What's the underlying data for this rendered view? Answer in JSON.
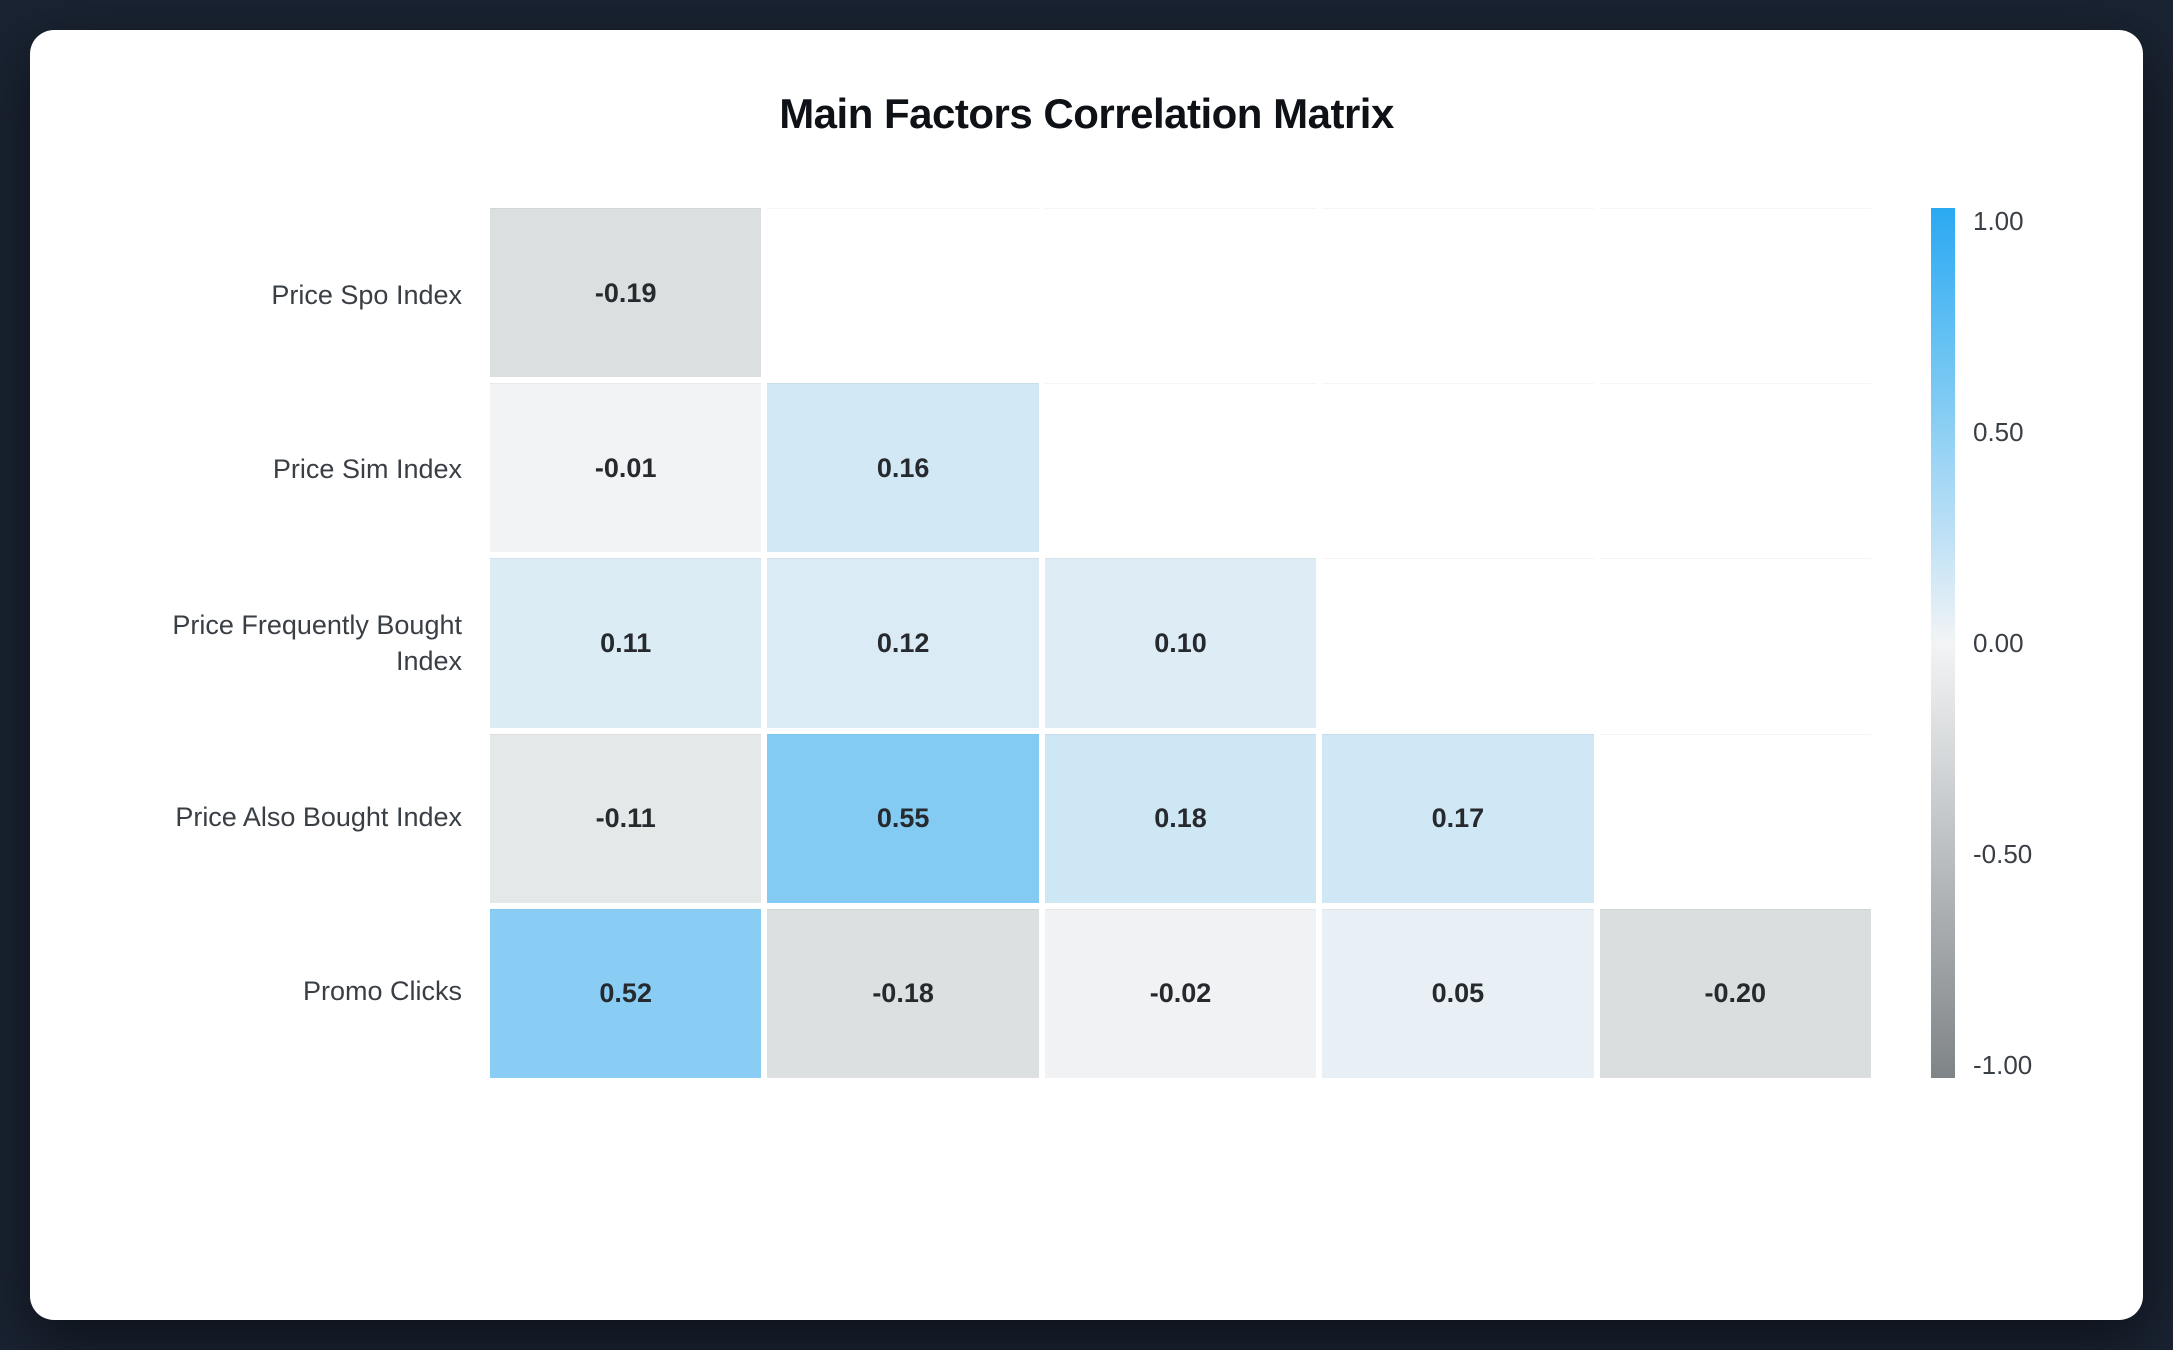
{
  "title": "Main Factors Correlation Matrix",
  "chart_data": {
    "type": "heatmap",
    "title": "Main Factors Correlation Matrix",
    "row_labels": [
      "Price Spo Index",
      "Price Sim Index",
      "Price Frequently Bought Index",
      "Price Also Bought Index",
      "Promo Clicks"
    ],
    "columns": 5,
    "matrix": [
      [
        -0.19,
        null,
        null,
        null,
        null
      ],
      [
        -0.01,
        0.16,
        null,
        null,
        null
      ],
      [
        0.11,
        0.12,
        0.1,
        null,
        null
      ],
      [
        -0.11,
        0.55,
        0.18,
        0.17,
        null
      ],
      [
        0.52,
        -0.18,
        -0.02,
        0.05,
        -0.2
      ]
    ],
    "color_scale": {
      "min": -1.0,
      "max": 1.0,
      "ticks": [
        "1.00",
        "0.50",
        "0.00",
        "-0.50",
        "-1.00"
      ],
      "positive_color": "#2aa9f3",
      "zero_color": "#f2f4f5",
      "negative_color": "#7f8487"
    }
  }
}
